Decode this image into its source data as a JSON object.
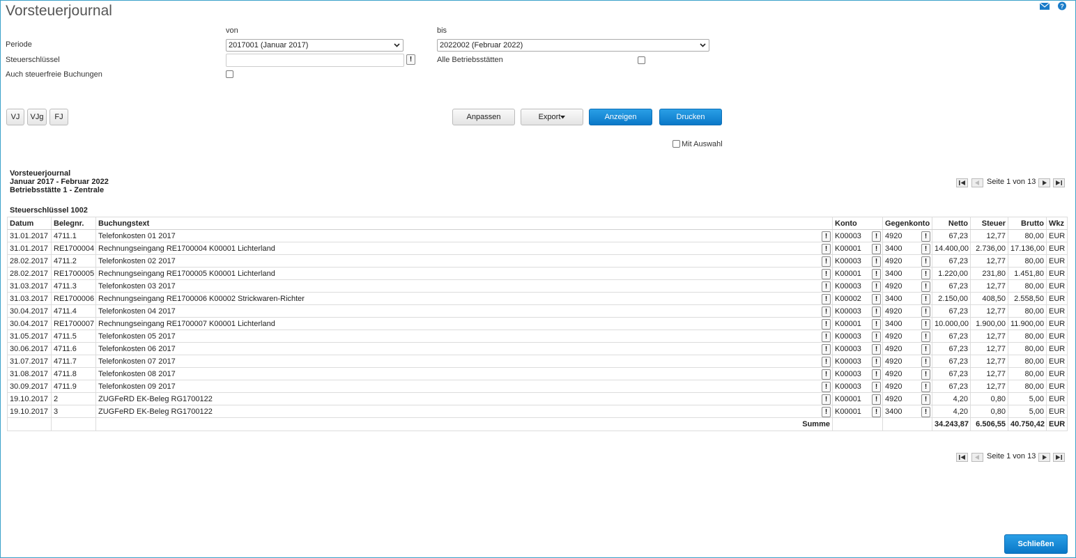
{
  "page_title": "Vorsteuerjournal",
  "filters": {
    "von_label": "von",
    "bis_label": "bis",
    "periode_label": "Periode",
    "periode_von_value": "2017001 (Januar 2017)",
    "periode_bis_value": "2022002 (Februar 2022)",
    "steuerschluessel_label": "Steuerschlüssel",
    "steuerschluessel_value": "",
    "alle_betriebsstaetten_label": "Alle Betriebsstätten",
    "auch_steuerfreie_label": "Auch steuerfreie Buchungen",
    "mit_auswahl_label": "Mit Auswahl"
  },
  "journal_buttons": [
    "VJ",
    "VJg",
    "FJ"
  ],
  "actions": {
    "anpassen": "Anpassen",
    "export": "Export",
    "anzeigen": "Anzeigen",
    "drucken": "Drucken",
    "schliessen": "Schließen"
  },
  "report": {
    "title": "Vorsteuerjournal",
    "range": "Januar 2017 - Februar 2022",
    "betriebsstaette": "Betriebsstätte 1 - Zentrale",
    "section": "Steuerschlüssel 1002"
  },
  "pager": {
    "text": "Seite 1 von 13"
  },
  "table": {
    "columns": {
      "datum": "Datum",
      "belegnr": "Belegnr.",
      "buchungstext": "Buchungstext",
      "konto": "Konto",
      "gegenkonto": "Gegenkonto",
      "netto": "Netto",
      "steuer": "Steuer",
      "brutto": "Brutto",
      "wkz": "Wkz"
    },
    "rows": [
      [
        "31.01.2017",
        "4711.1",
        "Telefonkosten 01 2017",
        "K00003",
        "4920",
        "67,23",
        "12,77",
        "80,00",
        "EUR"
      ],
      [
        "31.01.2017",
        "RE1700004",
        "Rechnungseingang RE1700004 K00001 Lichterland",
        "K00001",
        "3400",
        "14.400,00",
        "2.736,00",
        "17.136,00",
        "EUR"
      ],
      [
        "28.02.2017",
        "4711.2",
        "Telefonkosten 02 2017",
        "K00003",
        "4920",
        "67,23",
        "12,77",
        "80,00",
        "EUR"
      ],
      [
        "28.02.2017",
        "RE1700005",
        "Rechnungseingang RE1700005 K00001 Lichterland",
        "K00001",
        "3400",
        "1.220,00",
        "231,80",
        "1.451,80",
        "EUR"
      ],
      [
        "31.03.2017",
        "4711.3",
        "Telefonkosten 03 2017",
        "K00003",
        "4920",
        "67,23",
        "12,77",
        "80,00",
        "EUR"
      ],
      [
        "31.03.2017",
        "RE1700006",
        "Rechnungseingang RE1700006 K00002 Strickwaren-Richter",
        "K00002",
        "3400",
        "2.150,00",
        "408,50",
        "2.558,50",
        "EUR"
      ],
      [
        "30.04.2017",
        "4711.4",
        "Telefonkosten 04 2017",
        "K00003",
        "4920",
        "67,23",
        "12,77",
        "80,00",
        "EUR"
      ],
      [
        "30.04.2017",
        "RE1700007",
        "Rechnungseingang RE1700007 K00001 Lichterland",
        "K00001",
        "3400",
        "10.000,00",
        "1.900,00",
        "11.900,00",
        "EUR"
      ],
      [
        "31.05.2017",
        "4711.5",
        "Telefonkosten 05 2017",
        "K00003",
        "4920",
        "67,23",
        "12,77",
        "80,00",
        "EUR"
      ],
      [
        "30.06.2017",
        "4711.6",
        "Telefonkosten 06 2017",
        "K00003",
        "4920",
        "67,23",
        "12,77",
        "80,00",
        "EUR"
      ],
      [
        "31.07.2017",
        "4711.7",
        "Telefonkosten 07 2017",
        "K00003",
        "4920",
        "67,23",
        "12,77",
        "80,00",
        "EUR"
      ],
      [
        "31.08.2017",
        "4711.8",
        "Telefonkosten 08 2017",
        "K00003",
        "4920",
        "67,23",
        "12,77",
        "80,00",
        "EUR"
      ],
      [
        "30.09.2017",
        "4711.9",
        "Telefonkosten 09 2017",
        "K00003",
        "4920",
        "67,23",
        "12,77",
        "80,00",
        "EUR"
      ],
      [
        "19.10.2017",
        "2",
        "ZUGFeRD EK-Beleg RG1700122",
        "K00001",
        "4920",
        "4,20",
        "0,80",
        "5,00",
        "EUR"
      ],
      [
        "19.10.2017",
        "3",
        "ZUGFeRD EK-Beleg RG1700122",
        "K00001",
        "3400",
        "4,20",
        "0,80",
        "5,00",
        "EUR"
      ]
    ],
    "summary": {
      "label": "Summe",
      "netto": "34.243,87",
      "steuer": "6.506,55",
      "brutto": "40.750,42",
      "wkz": "EUR"
    }
  },
  "icons": {
    "mail": "mail-icon",
    "help": "help-icon",
    "accent": "#0a78c8"
  }
}
